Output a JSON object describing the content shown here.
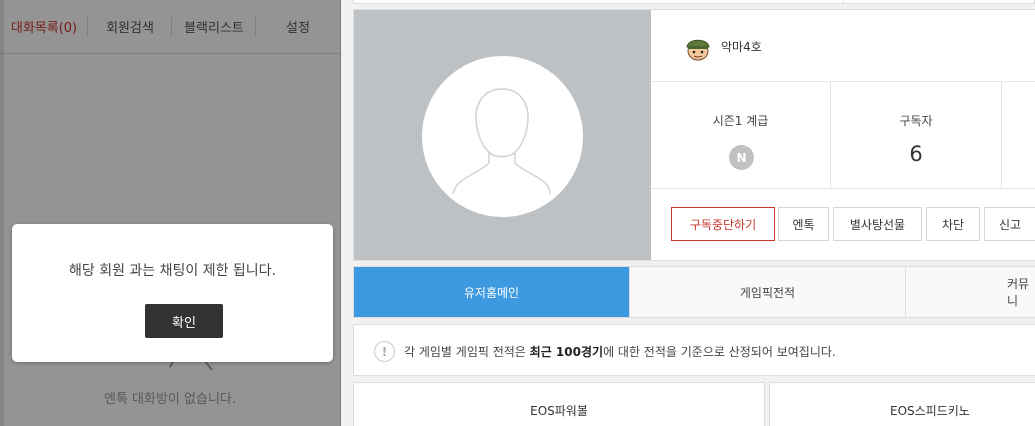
{
  "chat_panel": {
    "tabs": [
      {
        "label": "대화목록(0)"
      },
      {
        "label": "회원검색"
      },
      {
        "label": "블랙리스트"
      },
      {
        "label": "설정"
      }
    ],
    "empty_message": "엔톡 대화방이 없습니다."
  },
  "dialog": {
    "message": "해당 회원 과는 채팅이 제한 됩니다.",
    "confirm_label": "확인"
  },
  "profile": {
    "nickname": "악마4호",
    "stats": {
      "season_grade_label": "시즌1 계급",
      "grade_badge": "N",
      "subscribers_label": "구독자",
      "subscribers_value": "6"
    },
    "actions": {
      "unsubscribe": "구독중단하기",
      "entalk": "엔톡",
      "gift": "별사탕선물",
      "block": "차단",
      "report": "신고"
    }
  },
  "main_tabs": [
    {
      "label": "유저홈메인",
      "active": true
    },
    {
      "label": "게임픽전적",
      "active": false
    },
    {
      "label": "커뮤니",
      "active": false
    }
  ],
  "notice": {
    "prefix": "각 게임별 게임픽 전적은 ",
    "highlight": "최근 100경기",
    "suffix": "에 대한 전적을 기준으로 산정되어 보여집니다."
  },
  "games": [
    {
      "label": "EOS파워볼"
    },
    {
      "label": "EOS스피드키노"
    }
  ],
  "colors": {
    "accent_red": "#c8352b",
    "tab_active_blue": "#3d9ae0",
    "photo_bg": "#bdc1c4",
    "grade_badge_gray": "#c1c1c1"
  }
}
